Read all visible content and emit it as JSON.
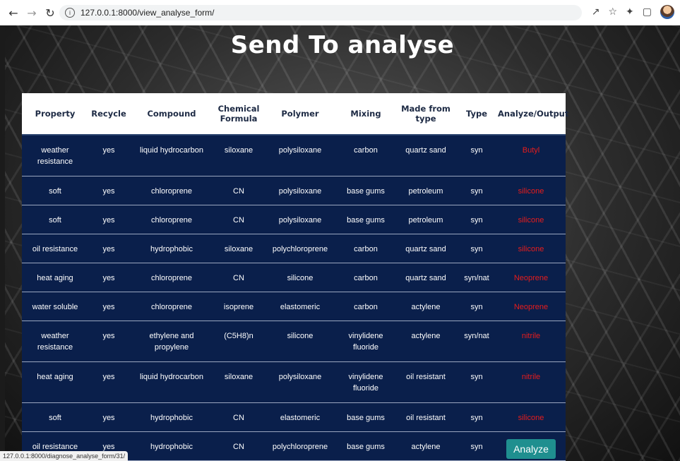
{
  "browser": {
    "url": "127.0.0.1:8000/view_analyse_form/",
    "status_url": "127.0.0.1:8000/diagnose_analyse_form/31/"
  },
  "page": {
    "title": "Send To analyse"
  },
  "table": {
    "headers": [
      "Property",
      "Recycle",
      "Compound",
      "Chemical Formula",
      "Polymer",
      "Mixing",
      "Made from type",
      "Type",
      "Analyze/Output"
    ],
    "rows": [
      [
        "weather resistance",
        "yes",
        "liquid hydrocarbon",
        "siloxane",
        "polysiloxane",
        "carbon",
        "quartz sand",
        "syn",
        "Butyl"
      ],
      [
        "soft",
        "yes",
        "chloroprene",
        "CN",
        "polysiloxane",
        "base gums",
        "petroleum",
        "syn",
        "silicone"
      ],
      [
        "soft",
        "yes",
        "chloroprene",
        "CN",
        "polysiloxane",
        "base gums",
        "petroleum",
        "syn",
        "silicone"
      ],
      [
        "oil resistance",
        "yes",
        "hydrophobic",
        "siloxane",
        "polychloroprene",
        "carbon",
        "quartz sand",
        "syn",
        "silicone"
      ],
      [
        "heat aging",
        "yes",
        "chloroprene",
        "CN",
        "silicone",
        "carbon",
        "quartz sand",
        "syn/nat",
        "Neoprene"
      ],
      [
        "water soluble",
        "yes",
        "chloroprene",
        "isoprene",
        "elastomeric",
        "carbon",
        "actylene",
        "syn",
        "Neoprene"
      ],
      [
        "weather resistance",
        "yes",
        "ethylene and propylene",
        "(C5H8)n",
        "silicone",
        "vinylidene fluoride",
        "actylene",
        "syn/nat",
        "nitrile"
      ],
      [
        "heat aging",
        "yes",
        "liquid hydrocarbon",
        "siloxane",
        "polysiloxane",
        "vinylidene fluoride",
        "oil resistant",
        "syn",
        "nitrile"
      ],
      [
        "soft",
        "yes",
        "hydrophobic",
        "CN",
        "elastomeric",
        "base gums",
        "oil resistant",
        "syn",
        "silicone"
      ],
      [
        "oil resistance",
        "yes",
        "hydrophobic",
        "CN",
        "polychloroprene",
        "base gums",
        "actylene",
        "syn",
        "Analyze"
      ]
    ]
  }
}
